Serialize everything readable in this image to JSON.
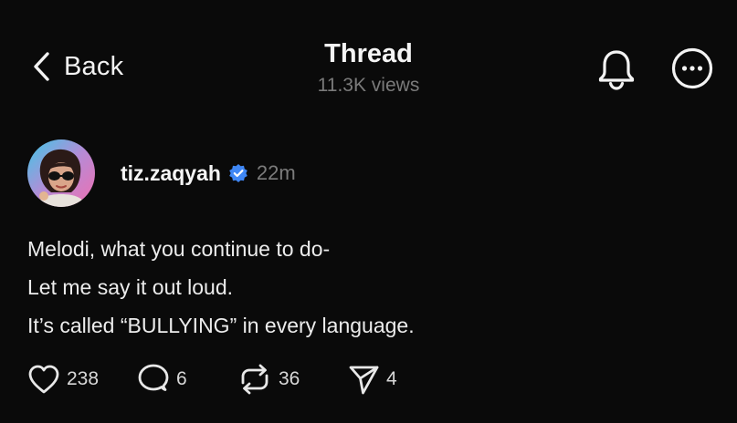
{
  "header": {
    "back_label": "Back",
    "title": "Thread",
    "views": "11.3K views",
    "icons": [
      "chevron-left-icon",
      "bell-icon",
      "more-icon"
    ]
  },
  "post": {
    "author": "tiz.zaqyah",
    "verified": true,
    "time": "22m",
    "lines": [
      "Melodi, what you continue to do-",
      "Let me say it out loud.",
      "It’s called “BULLYING” in every language."
    ]
  },
  "actions": {
    "likes": "238",
    "replies": "6",
    "reposts": "36",
    "shares": "4"
  },
  "colors": {
    "background": "#0a0a0a",
    "text": "#f3f3f3",
    "muted": "#7a7a7a",
    "verified": "#3f87f5"
  }
}
